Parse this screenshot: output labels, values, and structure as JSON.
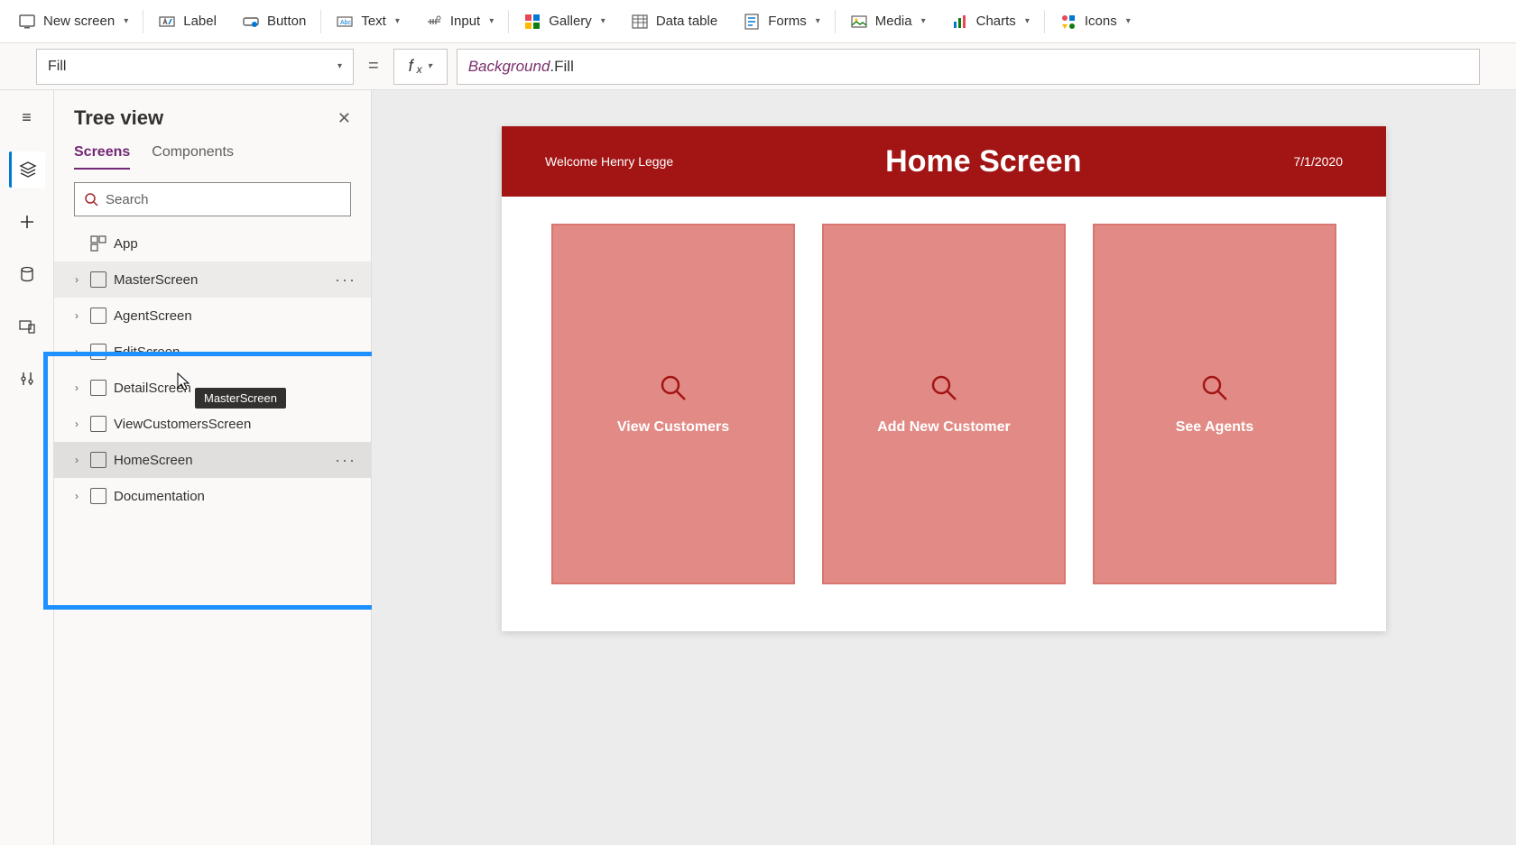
{
  "ribbon": {
    "new_screen": "New screen",
    "label": "Label",
    "button": "Button",
    "text": "Text",
    "input": "Input",
    "gallery": "Gallery",
    "data_table": "Data table",
    "forms": "Forms",
    "media": "Media",
    "charts": "Charts",
    "icons": "Icons"
  },
  "formula": {
    "property": "Fill",
    "ref": "Background",
    "prop": ".Fill"
  },
  "tree": {
    "title": "Tree view",
    "tabs": {
      "screens": "Screens",
      "components": "Components"
    },
    "search_placeholder": "Search",
    "app_label": "App",
    "items": [
      {
        "label": "MasterScreen"
      },
      {
        "label": "AgentScreen"
      },
      {
        "label": "EditScreen"
      },
      {
        "label": "DetailScreen"
      },
      {
        "label": "ViewCustomersScreen"
      },
      {
        "label": "HomeScreen"
      },
      {
        "label": "Documentation"
      }
    ],
    "tooltip": "MasterScreen"
  },
  "canvas": {
    "welcome": "Welcome Henry Legge",
    "title": "Home Screen",
    "date": "7/1/2020",
    "tiles": [
      {
        "label": "View Customers"
      },
      {
        "label": "Add New Customer"
      },
      {
        "label": "See Agents"
      }
    ]
  }
}
